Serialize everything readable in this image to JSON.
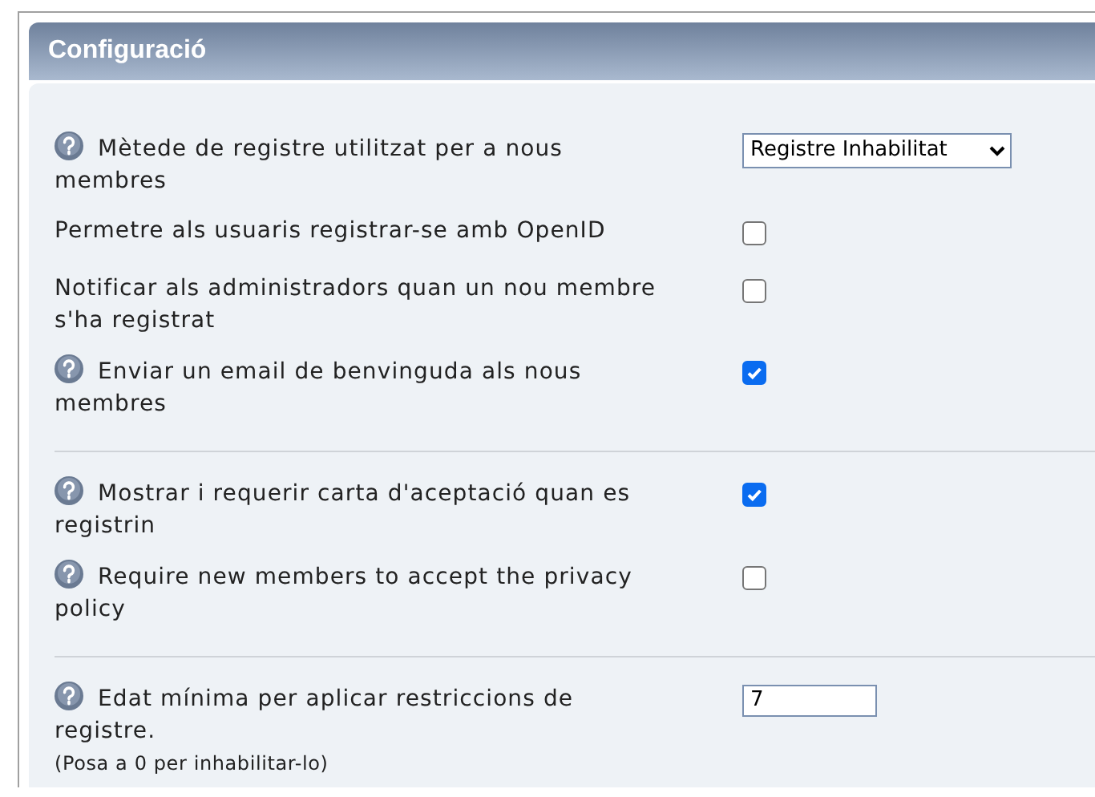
{
  "header": {
    "title": "Configuració"
  },
  "groups": [
    {
      "rows": [
        {
          "kind": "select",
          "help": true,
          "label": "Mètede de registre utilitzat per a nous membres",
          "value": "Registre Inhabilitat"
        },
        {
          "kind": "checkbox",
          "help": false,
          "label": "Permetre als usuaris registrar-se amb OpenID",
          "checked": false
        },
        {
          "kind": "checkbox",
          "help": false,
          "label": "Notificar als administradors quan un nou membre s'ha registrat",
          "checked": false
        },
        {
          "kind": "checkbox",
          "help": true,
          "label": "Enviar un email de benvinguda als nous membres",
          "checked": true
        }
      ]
    },
    {
      "rows": [
        {
          "kind": "checkbox",
          "help": true,
          "label": "Mostrar i requerir carta d'aceptació quan es registrin",
          "checked": true
        },
        {
          "kind": "checkbox",
          "help": true,
          "label": "Require new members to accept the privacy policy",
          "checked": false
        }
      ]
    },
    {
      "rows": [
        {
          "kind": "text",
          "help": true,
          "label": "Edat mínima per aplicar restriccions de registre.",
          "note": "(Posa a 0 per inhabilitar-lo)",
          "value": "7"
        }
      ]
    }
  ]
}
